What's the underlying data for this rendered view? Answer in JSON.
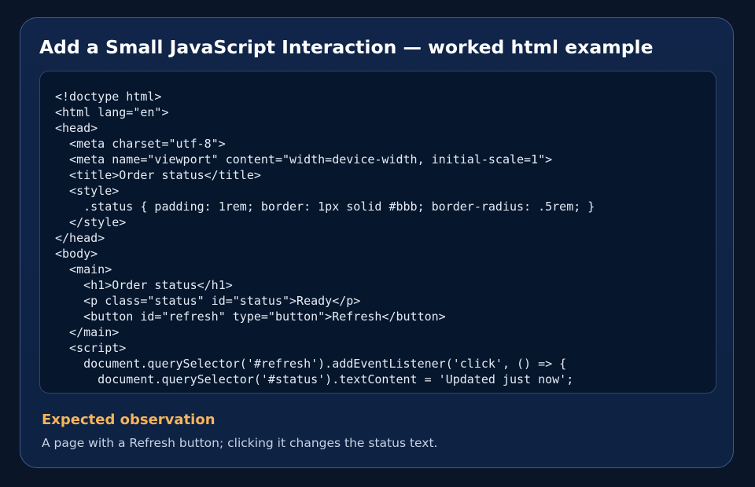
{
  "card": {
    "title": "Add a Small JavaScript Interaction — worked html example",
    "code": "<!doctype html>\n<html lang=\"en\">\n<head>\n  <meta charset=\"utf-8\">\n  <meta name=\"viewport\" content=\"width=device-width, initial-scale=1\">\n  <title>Order status</title>\n  <style>\n    .status { padding: 1rem; border: 1px solid #bbb; border-radius: .5rem; }\n  </style>\n</head>\n<body>\n  <main>\n    <h1>Order status</h1>\n    <p class=\"status\" id=\"status\">Ready</p>\n    <button id=\"refresh\" type=\"button\">Refresh</button>\n  </main>\n  <script>\n    document.querySelector('#refresh').addEventListener('click', () => {\n      document.querySelector('#status').textContent = 'Updated just now';",
    "observation_heading": "Expected observation",
    "observation_text": "A page with a Refresh button; clicking it changes the status text."
  },
  "colors": {
    "page_background": "#0a1628",
    "card_background": "#102549",
    "code_background": "#06162c",
    "heading_accent": "#f6b45a",
    "title_text": "#ffffff"
  }
}
